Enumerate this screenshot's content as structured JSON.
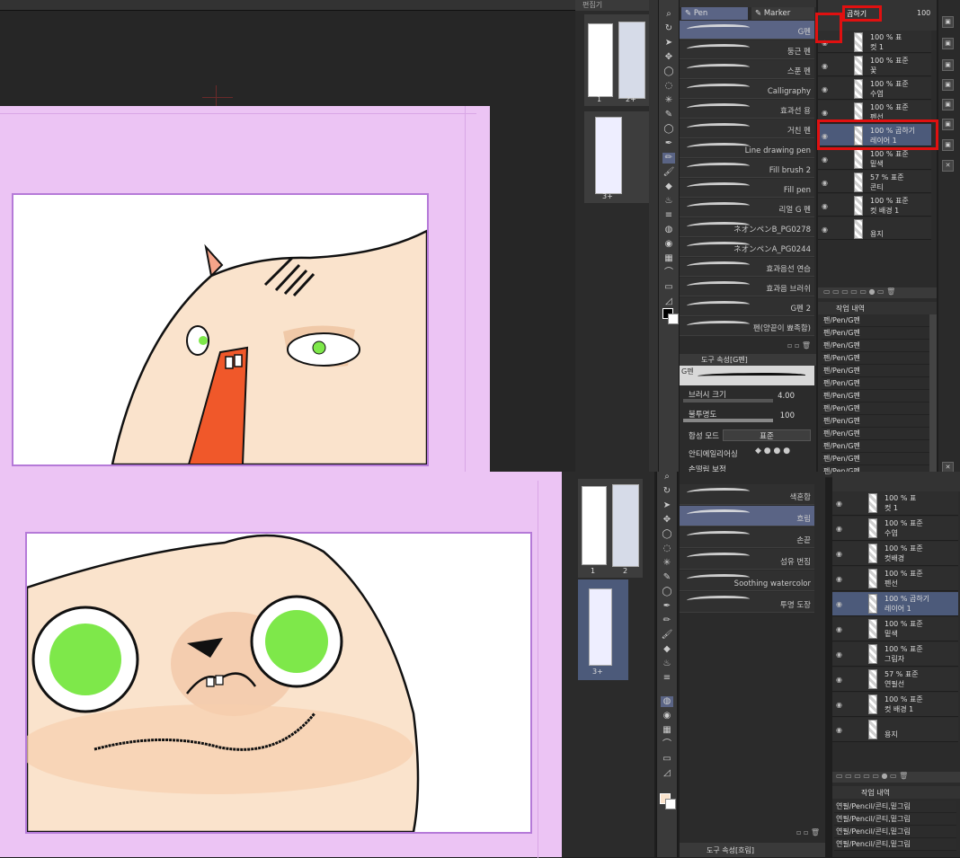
{
  "top": {
    "navigator_tab": "편집기",
    "pen_tab": "Pen",
    "marker_tab": "Marker",
    "layer_tab_highlight": "곱하기",
    "layer_opacity": "100",
    "page_labels": [
      "1",
      "2+",
      "3+"
    ],
    "brushes": [
      "G펜",
      "둥근 펜",
      "스푼 펜",
      "Calligraphy",
      "효과선 용",
      "거친 펜",
      "Line drawing pen",
      "Fill brush 2",
      "Fill pen",
      "리얼 G 펜",
      "ネオンペンB_PG0278",
      "ネオンペンA_PG0244",
      "효과음선 연습",
      "효과음 브러쉬",
      "G펜 2",
      "펜(양끝이 뾰족함)"
    ],
    "tool_property_tab": "도구 속성[G펜]",
    "tool_preview_label": "G펜",
    "brush_size_label": "브러시 크기",
    "brush_size_value": "4.00",
    "opacity_label": "불투명도",
    "opacity_value": "100",
    "blend_label": "합성 모드",
    "blend_value": "표준",
    "antialias_label": "안티에일리어싱",
    "stabilize_label": "손떨림 보정",
    "layers": [
      {
        "t1": "100 % 표",
        "t2": "컷 1"
      },
      {
        "t1": "100 % 표준",
        "t2": "꽃"
      },
      {
        "t1": "100 % 표준",
        "t2": "수염"
      },
      {
        "t1": "100 % 표준",
        "t2": "펜선"
      },
      {
        "t1": "100 % 곱하기",
        "t2": "레이어 1"
      },
      {
        "t1": "100 % 표준",
        "t2": "밑색"
      },
      {
        "t1": "57 % 표준",
        "t2": "콘티"
      },
      {
        "t1": "100 % 표준",
        "t2": "컷 배경 1"
      },
      {
        "t1": "",
        "t2": "용지"
      }
    ],
    "history_tab": "작업 내역",
    "history_items": [
      "펜/Pen/G펜",
      "펜/Pen/G펜",
      "펜/Pen/G펜",
      "펜/Pen/G펜",
      "펜/Pen/G펜",
      "펜/Pen/G펜",
      "펜/Pen/G펜",
      "펜/Pen/G펜",
      "펜/Pen/G펜",
      "펜/Pen/G펜",
      "펜/Pen/G펜",
      "펜/Pen/G펜",
      "펜/Pen/G펜"
    ]
  },
  "bottom": {
    "page_labels": [
      "1",
      "2",
      "3+"
    ],
    "brushes": [
      "색혼합",
      "흐림",
      "손끝",
      "섬유 번짐",
      "Soothing watercolor",
      "투명 도장"
    ],
    "tool_property_tab": "도구 속성[흐림]",
    "layers": [
      {
        "t1": "100 % 표",
        "t2": "컷 1"
      },
      {
        "t1": "100 % 표준",
        "t2": "수염"
      },
      {
        "t1": "100 % 표준",
        "t2": "컷배경"
      },
      {
        "t1": "100 % 표준",
        "t2": "펜선"
      },
      {
        "t1": "100 % 곱하기",
        "t2": "레이어 1"
      },
      {
        "t1": "100 % 표준",
        "t2": "밑색"
      },
      {
        "t1": "100 % 표준",
        "t2": "그림자"
      },
      {
        "t1": "57 % 표준",
        "t2": "연필선"
      },
      {
        "t1": "100 % 표준",
        "t2": "컷 배경 1"
      },
      {
        "t1": "",
        "t2": "용지"
      }
    ],
    "history_tab": "작업 내역",
    "history_items": [
      "연필/Pencil/콘티,밑그림",
      "연필/Pencil/콘티,밑그림",
      "연필/Pencil/콘티,밑그림",
      "연필/Pencil/콘티,밑그림"
    ]
  },
  "colors": {
    "canvas_pink": "#ecc4f4",
    "frame_border": "#b57ad8",
    "highlight": "#e01010",
    "selected_row": "#4c5a7a",
    "eye_green": "#7ee84a",
    "nose_orange": "#f0582a",
    "skin": "#fae3cc"
  }
}
